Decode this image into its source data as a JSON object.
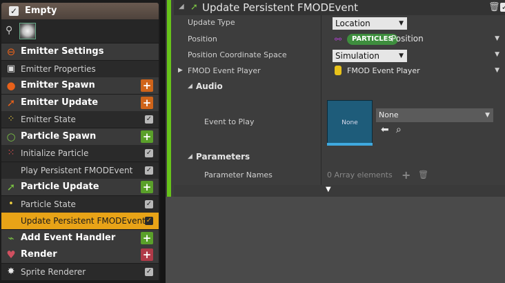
{
  "emitter": {
    "title": "Empty"
  },
  "stack": [
    {
      "label": "Emitter Settings",
      "kind": "section",
      "icon": "emitter-settings-icon",
      "color": "#e8611a"
    },
    {
      "label": "Emitter Properties",
      "kind": "item",
      "icon": "cpu-icon"
    },
    {
      "label": "Emitter Spawn",
      "kind": "section",
      "icon": "emitter-spawn-icon",
      "color": "#e8611a",
      "add": "o"
    },
    {
      "label": "Emitter Update",
      "kind": "section",
      "icon": "emitter-update-icon",
      "color": "#e8611a",
      "add": "o"
    },
    {
      "label": "Emitter State",
      "kind": "item",
      "icon": "state-dots-icon",
      "check": true
    },
    {
      "label": "Particle Spawn",
      "kind": "section",
      "icon": "particle-spawn-icon",
      "color": "#7ac143",
      "add": "g"
    },
    {
      "label": "Initialize Particle",
      "kind": "item",
      "icon": "grid-dots-icon",
      "check": true
    },
    {
      "label": "Play Persistent FMODEvent",
      "kind": "item",
      "icon": "",
      "check": true
    },
    {
      "label": "Particle Update",
      "kind": "section",
      "icon": "particle-update-icon",
      "color": "#7ac143",
      "add": "g"
    },
    {
      "label": "Particle State",
      "kind": "item",
      "icon": "dot-icon",
      "check": true
    },
    {
      "label": "Update Persistent FMODEvent",
      "kind": "sel",
      "icon": "",
      "check": true
    },
    {
      "label": "Add Event Handler",
      "kind": "section",
      "icon": "event-handler-icon",
      "color": "#7ac143",
      "add": "g"
    },
    {
      "label": "Render",
      "kind": "section",
      "icon": "render-icon",
      "color": "#d05060",
      "add": "r"
    },
    {
      "label": "Sprite Renderer",
      "kind": "item",
      "icon": "sprite-icon",
      "check": true
    }
  ],
  "panel": {
    "title": "Update Persistent FMODEvent",
    "update_type_label": "Update Type",
    "update_type_value": "Location",
    "position_label": "Position",
    "position_namespace": "PARTICLES",
    "position_value": "Position",
    "coord_space_label": "Position Coordinate Space",
    "coord_space_value": "Simulation",
    "event_player_label": "FMOD Event Player",
    "event_player_value": "FMOD Event Player",
    "audio_label": "Audio",
    "event_to_play_label": "Event to Play",
    "asset_thumb_text": "None",
    "asset_combo_value": "None",
    "parameters_label": "Parameters",
    "parameter_names_label": "Parameter Names",
    "parameter_names_value": "0 Array elements"
  }
}
